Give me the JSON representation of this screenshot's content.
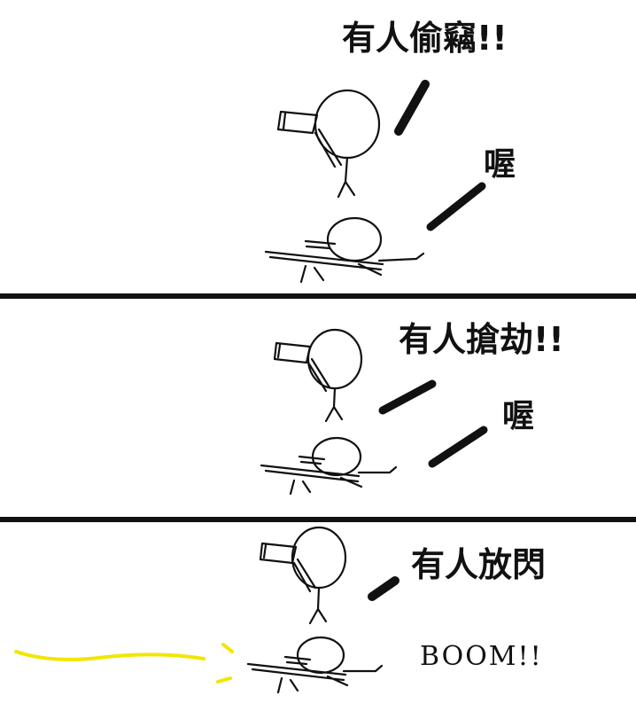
{
  "panels": [
    {
      "shout": "有人偷竊!!",
      "reply": "喔"
    },
    {
      "shout": "有人搶劫!!",
      "reply": "喔"
    },
    {
      "shout": "有人放閃",
      "sound": "BOOM!!"
    }
  ],
  "colors": {
    "ink": "#111111",
    "flash": "#f2e600",
    "background": "#ffffff"
  }
}
